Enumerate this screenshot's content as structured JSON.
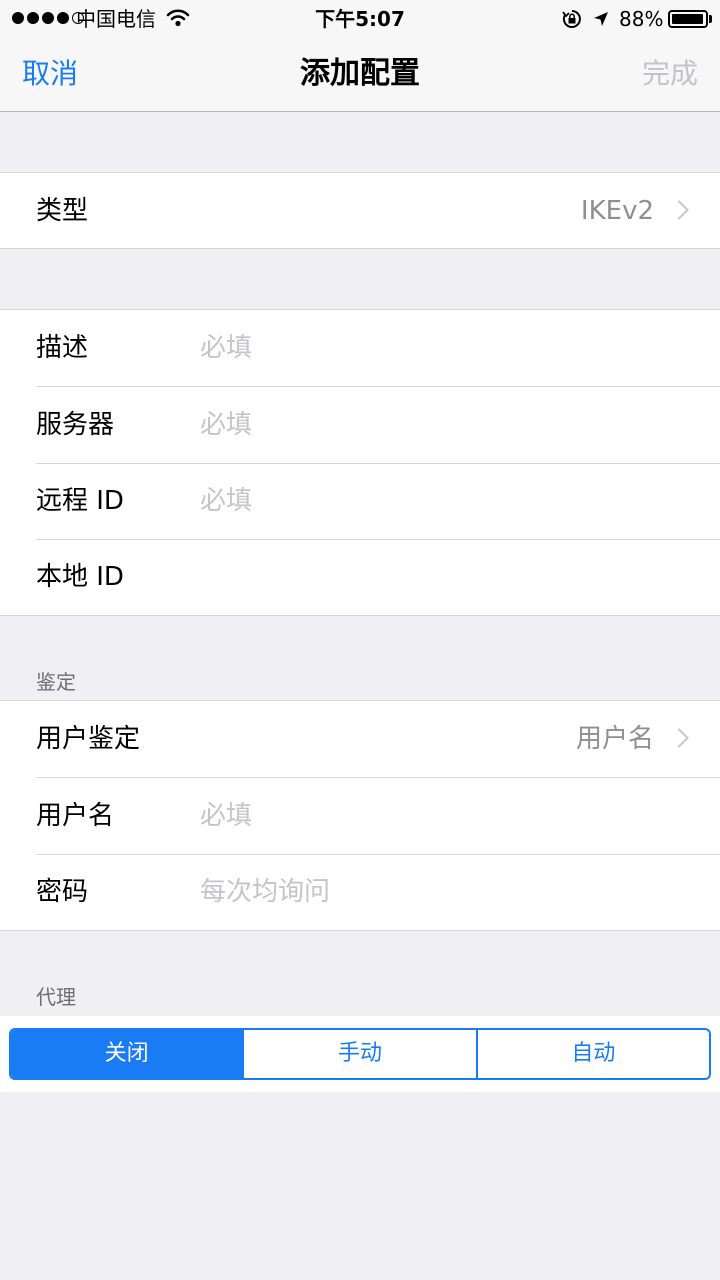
{
  "status_bar": {
    "carrier": "中国电信",
    "time": "下午5:07",
    "battery": "88%",
    "signal_bars": 4,
    "battery_level": 0.88
  },
  "nav": {
    "cancel": "取消",
    "title": "添加配置",
    "done": "完成"
  },
  "type_row": {
    "label": "类型",
    "value": "IKEv2"
  },
  "server_group": [
    {
      "label": "描述",
      "placeholder": "必填"
    },
    {
      "label": "服务器",
      "placeholder": "必填"
    },
    {
      "label": "远程 ID",
      "placeholder": "必填"
    },
    {
      "label": "本地 ID",
      "placeholder": ""
    }
  ],
  "auth": {
    "header": "鉴定",
    "user_auth": {
      "label": "用户鉴定",
      "value": "用户名"
    },
    "username": {
      "label": "用户名",
      "placeholder": "必填"
    },
    "password": {
      "label": "密码",
      "placeholder": "每次均询问"
    }
  },
  "proxy": {
    "header": "代理",
    "options": [
      "关闭",
      "手动",
      "自动"
    ],
    "selected": "关闭"
  },
  "colors": {
    "accent": "#1a7cf5",
    "background": "#efeff4"
  }
}
